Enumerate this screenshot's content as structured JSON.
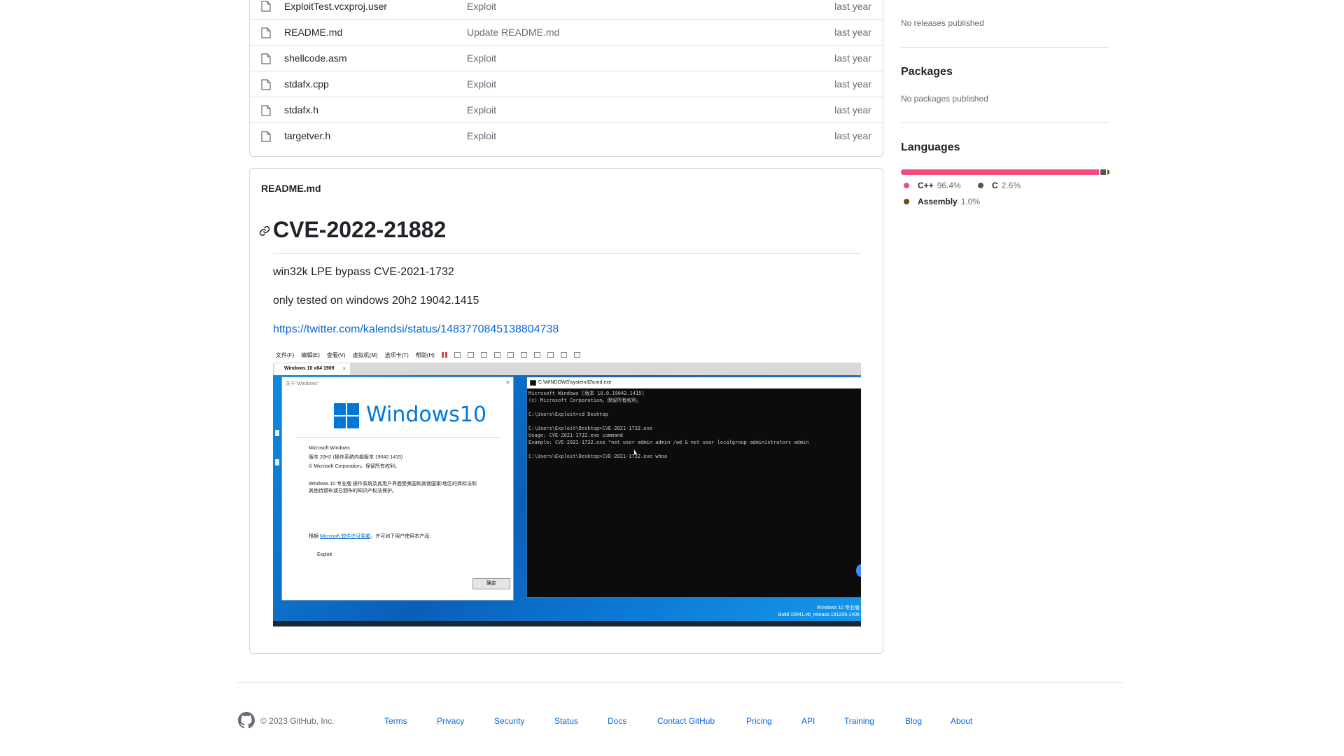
{
  "files": [
    {
      "name": "ExploitTest.vcxproj.user",
      "message": "Exploit",
      "age": "last year"
    },
    {
      "name": "README.md",
      "message": "Update README.md",
      "age": "last year"
    },
    {
      "name": "shellcode.asm",
      "message": "Exploit",
      "age": "last year"
    },
    {
      "name": "stdafx.cpp",
      "message": "Exploit",
      "age": "last year"
    },
    {
      "name": "stdafx.h",
      "message": "Exploit",
      "age": "last year"
    },
    {
      "name": "targetver.h",
      "message": "Exploit",
      "age": "last year"
    }
  ],
  "readme": {
    "filename": "README.md",
    "heading": "CVE-2022-21882",
    "paragraphs": [
      "win32k LPE bypass CVE-2021-1732",
      "only tested on windows 20h2 19042.1415"
    ],
    "link": "https://twitter.com/kalendsi/status/1483770845138804738",
    "screenshot": {
      "menu_items": [
        "文件(F)",
        "编辑(E)",
        "查看(V)",
        "虚拟机(M)",
        "选项卡(T)",
        "帮助(H)"
      ],
      "tab_label": "Windows 10 x64 1909",
      "about_title": "关于\"Windows\"",
      "brand": "Windows10",
      "about_lines": [
        "Microsoft Windows",
        "版本 20H2 (操作系统内部版本 19042.1415)",
        "© Microsoft Corporation。保留所有权利。",
        "Windows 10 专业版 操作系统及其用户界面受美国和其他国家/地区的商标法和",
        "其他待颁布或已颁布的知识产权法保护。"
      ],
      "license_prefix": "根据 ",
      "license_link": "Microsoft 软件许可条款",
      "license_suffix": "，许可如下用户使用本产品:",
      "licensee": "Exploit",
      "ok_label": "确定",
      "cmd_title": "C:\\WINDOWS\\system32\\cmd.exe",
      "cmd_lines": "Microsoft Windows [版本 10.0.19042.1415]\n(c) Microsoft Corporation。保留所有权利。\n\nC:\\Users\\Exploit>cd Desktop\n\nC:\\Users\\Exploit\\Desktop>CVE-2021-1732.exe\nUsage: CVE-2021-1732.exe command\nExample: CVE-2021-1732.exe \"net user admin admin /ad & net user localgroup administrators admin\n\nC:\\Users\\Exploit\\Desktop>CVE-2021-1732.exe whoa",
      "watermark_1": "Windows 10 专业版",
      "watermark_2": "Build 19041.vb_release.191206-1406"
    }
  },
  "sidebar": {
    "releases_text": "No releases published",
    "packages_heading": "Packages",
    "packages_text": "No packages published",
    "languages_heading": "Languages",
    "languages": [
      {
        "name": "C++",
        "percent": "96.4%",
        "value": 96.4,
        "color": "#f34b7d"
      },
      {
        "name": "C",
        "percent": "2.6%",
        "value": 2.6,
        "color": "#555555"
      },
      {
        "name": "Assembly",
        "percent": "1.0%",
        "value": 1.0,
        "color": "#6e4c13"
      }
    ]
  },
  "footer": {
    "copyright": "© 2023 GitHub, Inc.",
    "links": [
      "Terms",
      "Privacy",
      "Security",
      "Status",
      "Docs",
      "Contact GitHub",
      "Pricing",
      "API",
      "Training",
      "Blog",
      "About"
    ]
  },
  "icons": {
    "file": "file-icon",
    "link": "link-icon",
    "github": "github-logo-icon"
  }
}
